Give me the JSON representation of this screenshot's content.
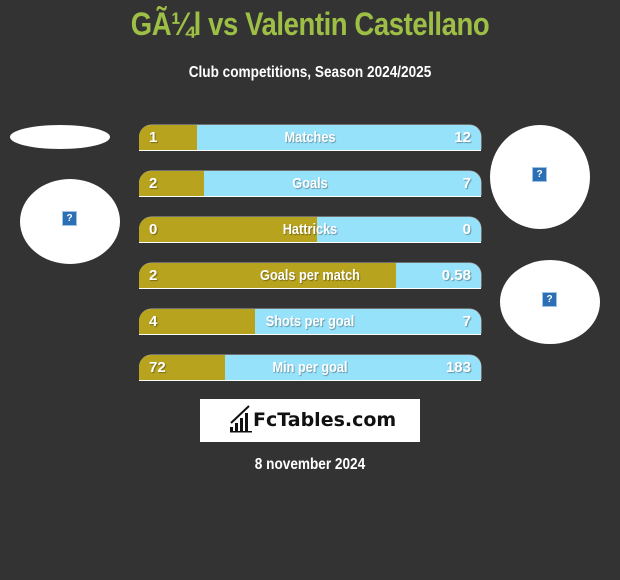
{
  "header": {
    "title": "GÃ¼l vs Valentin Castellano",
    "subtitle": "Club competitions, Season 2024/2025"
  },
  "colors": {
    "background": "#333333",
    "title": "#9dbf45",
    "left_bar": "#b8a31e",
    "right_bar": "#97e2fb"
  },
  "stats": [
    {
      "label": "Matches",
      "left": "1",
      "right": "12",
      "left_share": 0.17
    },
    {
      "label": "Goals",
      "left": "2",
      "right": "7",
      "left_share": 0.19
    },
    {
      "label": "Hattricks",
      "left": "0",
      "right": "0",
      "left_share": 0.52
    },
    {
      "label": "Goals per match",
      "left": "2",
      "right": "0.58",
      "left_share": 0.75
    },
    {
      "label": "Shots per goal",
      "left": "4",
      "right": "7",
      "left_share": 0.34
    },
    {
      "label": "Min per goal",
      "left": "72",
      "right": "183",
      "left_share": 0.25
    }
  ],
  "images": {
    "placeholder_glyph": "?"
  },
  "logo": {
    "text": "FcTables.com",
    "icon": "bar-chart-icon"
  },
  "footer": {
    "date": "8 november 2024"
  }
}
